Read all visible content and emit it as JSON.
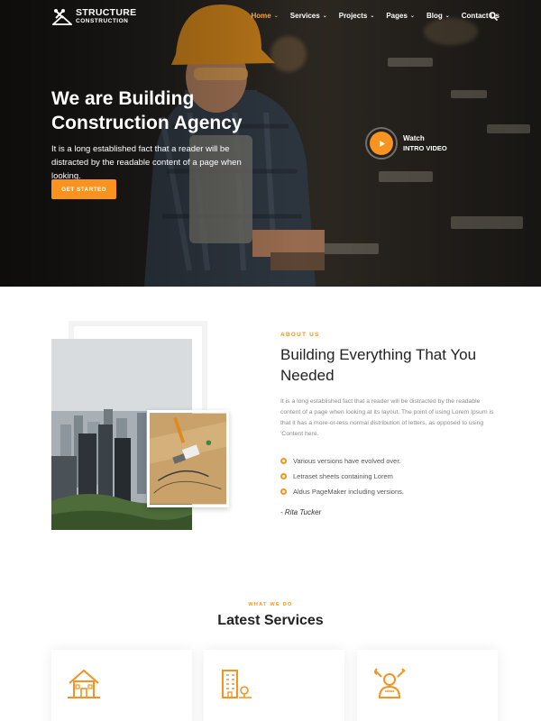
{
  "brand": {
    "title": "STRUCTURE",
    "subtitle": "CONSTRUCTION"
  },
  "nav": {
    "items": [
      {
        "label": "Home",
        "has_dropdown": true,
        "active": true
      },
      {
        "label": "Services",
        "has_dropdown": true,
        "active": false
      },
      {
        "label": "Projects",
        "has_dropdown": true,
        "active": false
      },
      {
        "label": "Pages",
        "has_dropdown": true,
        "active": false
      },
      {
        "label": "Blog",
        "has_dropdown": true,
        "active": false
      },
      {
        "label": "Contact Us",
        "has_dropdown": false,
        "active": false
      }
    ],
    "chevron": "⌄",
    "search_icon": "search-icon"
  },
  "hero": {
    "title": "We are Building Construction Agency",
    "text": "It is a long established fact that a reader will be distracted by the readable content of a page when looking.",
    "cta": "GET STARTED",
    "video_watch": "Watch",
    "video_intro": "INTRO VIDEO"
  },
  "about": {
    "eyebrow": "ABOUT US",
    "title": "Building Everything That You Needed",
    "text": "It is a long established fact that a reader will be distracted by the readable content of a page when looking at its layout. The point of using Lorem Ipsum is that it has a more-or-less normal distribution of letters, as opposed to using 'Content here.",
    "checklist": [
      "Various versions have evolved over.",
      "Letraset sheets containing Lorem",
      "Aldus PageMaker including versions."
    ],
    "author": "- Rita Tucker"
  },
  "services": {
    "eyebrow": "WHAT WE DO",
    "title": "Latest Services",
    "cards": [
      {
        "icon": "house-icon"
      },
      {
        "icon": "building-icon"
      },
      {
        "icon": "worker-tools-icon"
      }
    ]
  },
  "colors": {
    "accent": "#f7931e",
    "active_nav": "#f7a440",
    "text_dark": "#222222",
    "text_muted": "#8a8a8a"
  }
}
